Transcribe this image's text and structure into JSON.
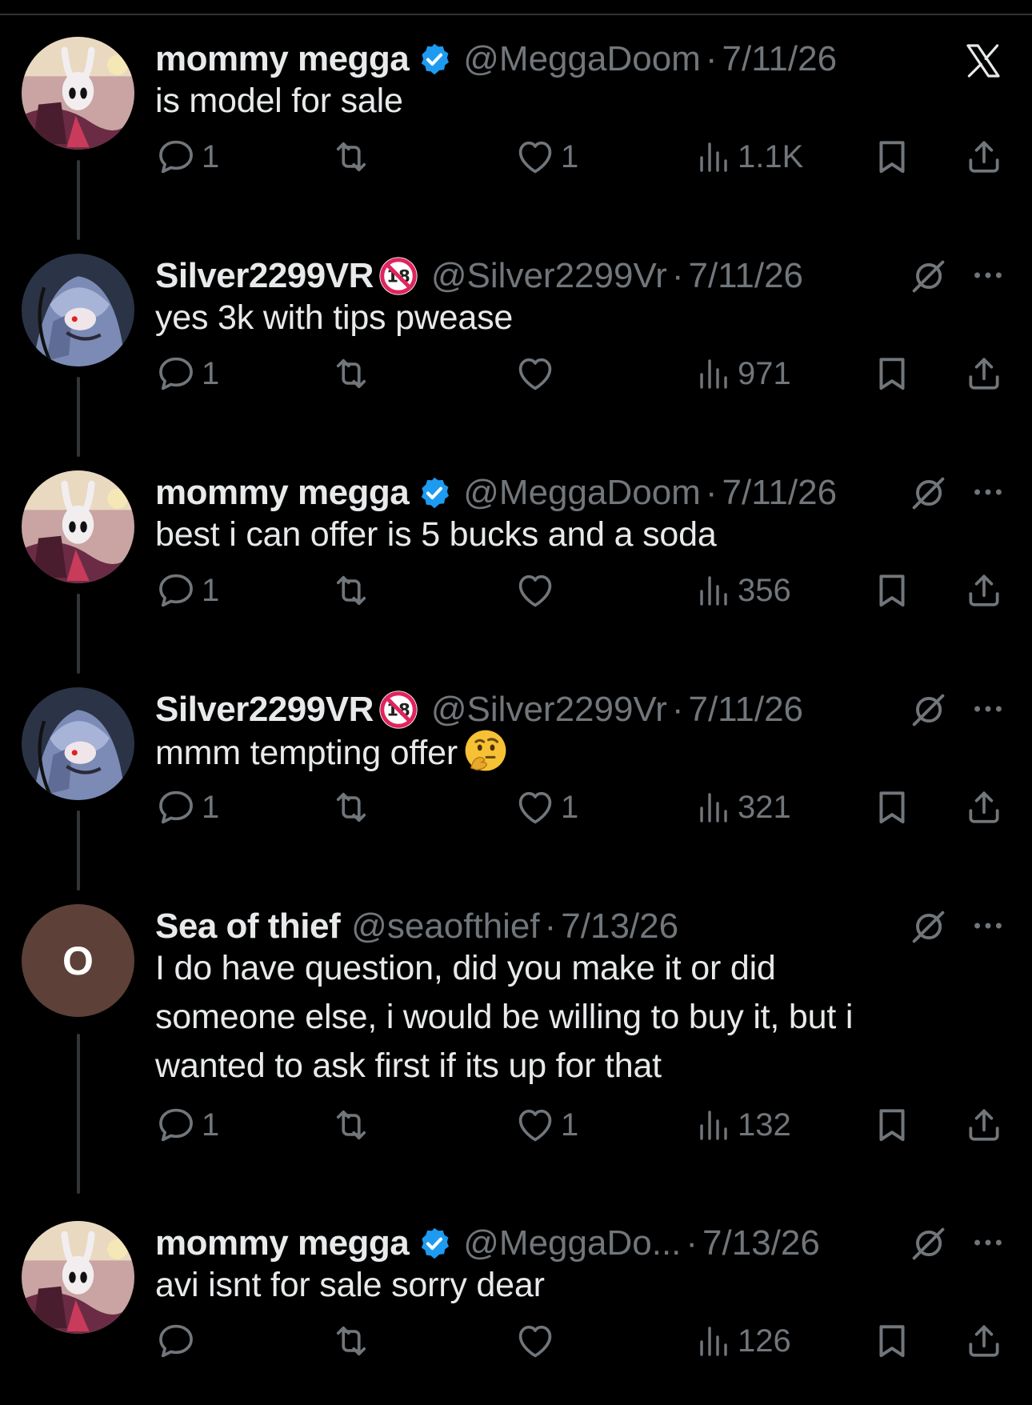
{
  "colors": {
    "background": "#000000",
    "text_primary": "#e7e9ea",
    "text_secondary": "#71767b",
    "verified_blue": "#1d9bf0",
    "connector": "#333639"
  },
  "tweets": [
    {
      "name": "mommy megga",
      "handle": "@MeggaDoom",
      "dot": "·",
      "date": "7/11/26",
      "text": "is model for sale",
      "replies": "1",
      "retweets": "",
      "likes": "1",
      "views": "1.1K"
    },
    {
      "name": "Silver2299VR",
      "handle": "@Silver2299Vr",
      "dot": "·",
      "date": "7/11/26",
      "text": "yes 3k with tips pwease",
      "replies": "1",
      "retweets": "",
      "likes": "",
      "views": "971"
    },
    {
      "name": "mommy megga",
      "handle": "@MeggaDoom",
      "dot": "·",
      "date": "7/11/26",
      "text": "best i can offer is 5 bucks and a soda",
      "replies": "1",
      "retweets": "",
      "likes": "",
      "views": "356"
    },
    {
      "name": "Silver2299VR",
      "handle": "@Silver2299Vr",
      "dot": "·",
      "date": "7/11/26",
      "text": "mmm tempting offer",
      "replies": "1",
      "retweets": "",
      "likes": "1",
      "views": "321"
    },
    {
      "name": "Sea of thief",
      "handle": "@seaofthief",
      "dot": "·",
      "date": "7/13/26",
      "avatar_letter": "O",
      "text_lines": [
        "I do have question, did you make it or did",
        "someone else, i would be willing to buy it, but i",
        "wanted to ask first if its up for that"
      ],
      "replies": "1",
      "retweets": "",
      "likes": "1",
      "views": "132"
    },
    {
      "name": "mommy megga",
      "handle": "@MeggaDo...",
      "dot": "·",
      "date": "7/13/26",
      "text": "avi isnt for sale sorry dear",
      "replies": "",
      "retweets": "",
      "likes": "",
      "views": "126"
    }
  ]
}
